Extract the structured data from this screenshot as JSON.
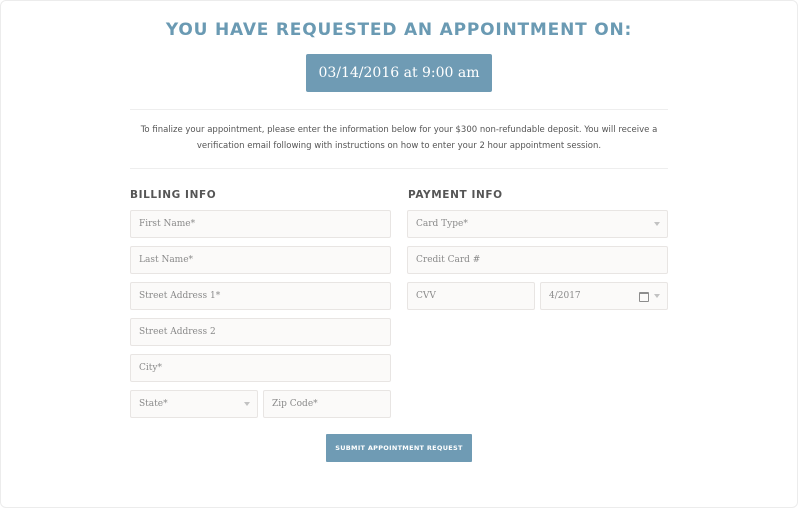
{
  "header": {
    "title": "YOU HAVE REQUESTED AN APPOINTMENT ON:",
    "appointment_datetime": "03/14/2016 at 9:00 am"
  },
  "intro": {
    "text": "To finalize your appointment, please enter the information below for your $300 non-refundable deposit.  You will receive a verification email following with instructions on how to enter your 2 hour appointment session."
  },
  "billing": {
    "title": "BILLING INFO",
    "first_name_placeholder": "First Name*",
    "last_name_placeholder": "Last Name*",
    "street1_placeholder": "Street Address 1*",
    "street2_placeholder": "Street Address 2",
    "city_placeholder": "City*",
    "state_label": "State*",
    "zip_placeholder": "Zip Code*"
  },
  "payment": {
    "title": "PAYMENT INFO",
    "card_type_label": "Card Type*",
    "credit_card_placeholder": "Credit Card #",
    "cvv_placeholder": "CVV",
    "expiry_value": "4/2017"
  },
  "submit_label": "SUBMIT APPOINTMENT REQUEST",
  "colors": {
    "accent": "#6f9bb4",
    "heading": "#6a9ab3",
    "field_bg": "#fbfaf9",
    "field_border": "#e8e5e3"
  },
  "icons": {
    "dropdown": "chevron-down-icon",
    "calendar": "calendar-icon"
  }
}
